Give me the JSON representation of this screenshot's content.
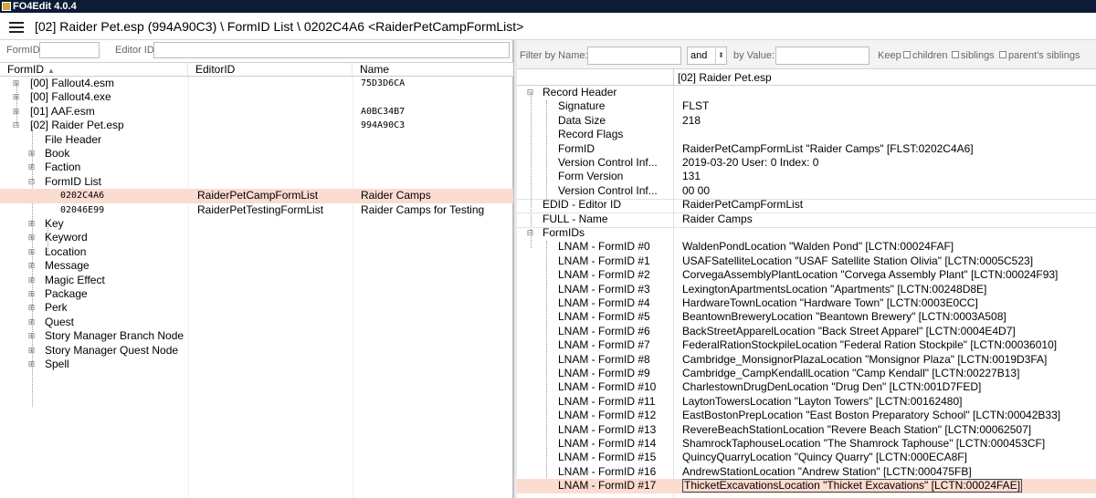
{
  "window": {
    "title": "FO4Edit 4.0.4",
    "icon": "fo4edit-app-icon"
  },
  "header": {
    "path": "[02] Raider Pet.esp (994A90C3) \\ FormID List \\ 0202C4A6 <RaiderPetCampFormList>"
  },
  "left_filter": {
    "formid_label": "FormID",
    "formid_value": "",
    "editorid_label": "Editor ID",
    "editorid_value": ""
  },
  "tree": {
    "columns": [
      "FormID",
      "EditorID",
      "Name"
    ],
    "rows": [
      {
        "label": "[00] Fallout4.esm",
        "editorid": "",
        "name": "75D3D6CA"
      },
      {
        "label": "[00] Fallout4.exe",
        "editorid": "",
        "name": ""
      },
      {
        "label": "[01] AAF.esm",
        "editorid": "",
        "name": "A0BC34B7"
      },
      {
        "label": "[02] Raider Pet.esp",
        "editorid": "",
        "name": "994A90C3"
      },
      {
        "label": "File Header",
        "editorid": "",
        "name": ""
      },
      {
        "label": "Book",
        "editorid": "",
        "name": ""
      },
      {
        "label": "Faction",
        "editorid": "",
        "name": ""
      },
      {
        "label": "FormID List",
        "editorid": "",
        "name": ""
      },
      {
        "label": "0202C4A6",
        "editorid": "RaiderPetCampFormList",
        "name": "Raider Camps"
      },
      {
        "label": "02046E99",
        "editorid": "RaiderPetTestingFormList",
        "name": "Raider Camps for Testing"
      },
      {
        "label": "Key",
        "editorid": "",
        "name": ""
      },
      {
        "label": "Keyword",
        "editorid": "",
        "name": ""
      },
      {
        "label": "Location",
        "editorid": "",
        "name": ""
      },
      {
        "label": "Message",
        "editorid": "",
        "name": ""
      },
      {
        "label": "Magic Effect",
        "editorid": "",
        "name": ""
      },
      {
        "label": "Package",
        "editorid": "",
        "name": ""
      },
      {
        "label": "Perk",
        "editorid": "",
        "name": ""
      },
      {
        "label": "Quest",
        "editorid": "",
        "name": ""
      },
      {
        "label": "Story Manager Branch Node",
        "editorid": "",
        "name": ""
      },
      {
        "label": "Story Manager Quest Node",
        "editorid": "",
        "name": ""
      },
      {
        "label": "Spell",
        "editorid": "",
        "name": ""
      }
    ]
  },
  "right_filter": {
    "by_name_label": "Filter by Name:",
    "name_value": "",
    "operator": "and",
    "by_value_label": "by Value:",
    "value_value": "",
    "keep_label": "Keep",
    "children_label": "children",
    "siblings_label": "siblings",
    "parents_siblings_label": "parent's siblings"
  },
  "record": {
    "file_header": "[02] Raider Pet.esp",
    "rows": [
      {
        "name": "Record Header",
        "value": ""
      },
      {
        "name": "Signature",
        "value": "FLST"
      },
      {
        "name": "Data Size",
        "value": "218"
      },
      {
        "name": "Record Flags",
        "value": ""
      },
      {
        "name": "FormID",
        "value": "RaiderPetCampFormList \"Raider Camps\" [FLST:0202C4A6]"
      },
      {
        "name": "Version Control Inf...",
        "value": "2019-03-20 User: 0 Index: 0"
      },
      {
        "name": "Form Version",
        "value": "131"
      },
      {
        "name": "Version Control Inf...",
        "value": "00 00"
      },
      {
        "name": "EDID - Editor ID",
        "value": "RaiderPetCampFormList"
      },
      {
        "name": "FULL - Name",
        "value": "Raider Camps"
      },
      {
        "name": "FormIDs",
        "value": ""
      },
      {
        "name": "LNAM - FormID #0",
        "value": "WaldenPondLocation \"Walden Pond\" [LCTN:00024FAF]"
      },
      {
        "name": "LNAM - FormID #1",
        "value": "USAFSatelliteLocation \"USAF Satellite Station Olivia\" [LCTN:0005C523]"
      },
      {
        "name": "LNAM - FormID #2",
        "value": "CorvegaAssemblyPlantLocation \"Corvega Assembly Plant\" [LCTN:00024F93]"
      },
      {
        "name": "LNAM - FormID #3",
        "value": "LexingtonApartmentsLocation \"Apartments\" [LCTN:00248D8E]"
      },
      {
        "name": "LNAM - FormID #4",
        "value": "HardwareTownLocation \"Hardware Town\" [LCTN:0003E0CC]"
      },
      {
        "name": "LNAM - FormID #5",
        "value": "BeantownBreweryLocation \"Beantown Brewery\" [LCTN:0003A508]"
      },
      {
        "name": "LNAM - FormID #6",
        "value": "BackStreetApparelLocation \"Back Street Apparel\" [LCTN:0004E4D7]"
      },
      {
        "name": "LNAM - FormID #7",
        "value": "FederalRationStockpileLocation \"Federal Ration Stockpile\" [LCTN:00036010]"
      },
      {
        "name": "LNAM - FormID #8",
        "value": "Cambridge_MonsignorPlazaLocation \"Monsignor Plaza\" [LCTN:0019D3FA]"
      },
      {
        "name": "LNAM - FormID #9",
        "value": "Cambridge_CampKendallLocation \"Camp Kendall\" [LCTN:00227B13]"
      },
      {
        "name": "LNAM - FormID #10",
        "value": "CharlestownDrugDenLocation \"Drug Den\" [LCTN:001D7FED]"
      },
      {
        "name": "LNAM - FormID #11",
        "value": "LaytonTowersLocation \"Layton Towers\" [LCTN:00162480]"
      },
      {
        "name": "LNAM - FormID #12",
        "value": "EastBostonPrepLocation \"East Boston Preparatory School\" [LCTN:00042B33]"
      },
      {
        "name": "LNAM - FormID #13",
        "value": "RevereBeachStationLocation \"Revere Beach Station\" [LCTN:00062507]"
      },
      {
        "name": "LNAM - FormID #14",
        "value": "ShamrockTaphouseLocation \"The Shamrock Taphouse\" [LCTN:000453CF]"
      },
      {
        "name": "LNAM - FormID #15",
        "value": "QuincyQuarryLocation \"Quincy Quarry\" [LCTN:000ECA8F]"
      },
      {
        "name": "LNAM - FormID #16",
        "value": "AndrewStationLocation \"Andrew Station\" [LCTN:000475FB]"
      },
      {
        "name": "LNAM - FormID #17",
        "value": "ThicketExcavationsLocation \"Thicket Excavations\" [LCTN:00024FAE]"
      }
    ]
  }
}
